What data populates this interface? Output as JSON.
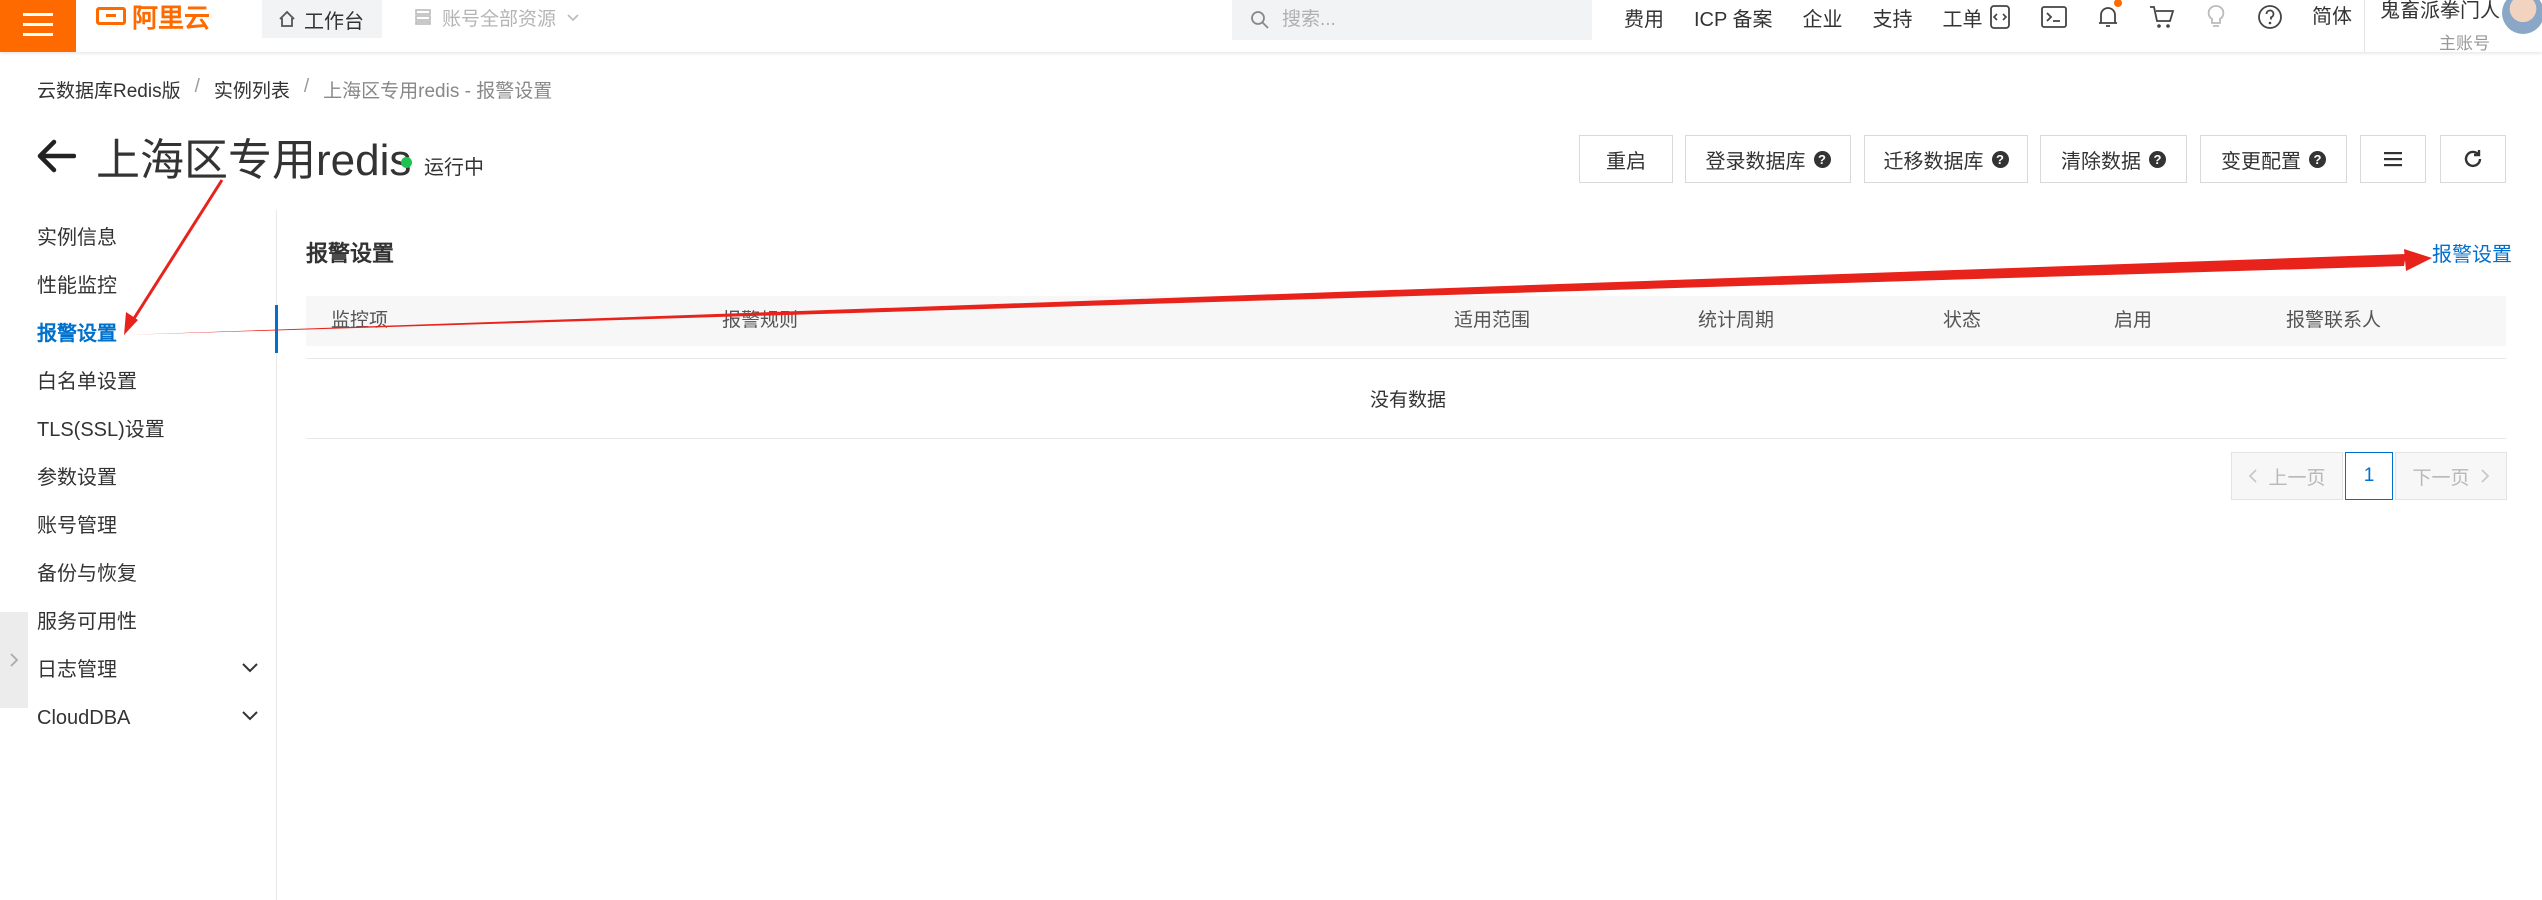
{
  "topbar": {
    "logo_text": "阿里云",
    "workbench_label": "工作台",
    "resource_scope_label": "账号全部资源",
    "search": {
      "placeholder": "搜索..."
    },
    "nav_links": [
      "费用",
      "ICP 备案",
      "企业",
      "支持",
      "工单"
    ],
    "icons": [
      "code-icon",
      "terminal-icon",
      "bell-icon",
      "cart-icon",
      "lightbulb-icon",
      "help-icon"
    ],
    "language": "简体",
    "account": {
      "name": "鬼畜派拳门人",
      "role": "主账号"
    }
  },
  "breadcrumb": [
    "云数据库Redis版",
    "实例列表",
    "上海区专用redis - 报警设置"
  ],
  "instance": {
    "title": "上海区专用redis",
    "status": "运行中",
    "status_color": "#1cc34c"
  },
  "toolbar": {
    "restart": "重启",
    "login_db": "登录数据库",
    "migrate_db": "迁移数据库",
    "clear_data": "清除数据",
    "change_config": "变更配置"
  },
  "sidebar": {
    "items": [
      {
        "label": "实例信息"
      },
      {
        "label": "性能监控"
      },
      {
        "label": "报警设置",
        "active": true
      },
      {
        "label": "白名单设置"
      },
      {
        "label": "TLS(SSL)设置"
      },
      {
        "label": "参数设置"
      },
      {
        "label": "账号管理"
      },
      {
        "label": "备份与恢复"
      },
      {
        "label": "服务可用性"
      },
      {
        "label": "日志管理",
        "expandable": true
      },
      {
        "label": "CloudDBA",
        "expandable": true
      }
    ]
  },
  "content": {
    "section_title": "报警设置",
    "alarm_link": "报警设置",
    "table": {
      "columns": [
        "监控项",
        "报警规则",
        "适用范围",
        "统计周期",
        "状态",
        "启用",
        "报警联系人"
      ],
      "empty_text": "没有数据"
    },
    "pagination": {
      "prev": "上一页",
      "current": "1",
      "next": "下一页"
    }
  },
  "colors": {
    "brand": "#ff6a00",
    "link": "#0070cc",
    "annotation": "#e8231c"
  }
}
